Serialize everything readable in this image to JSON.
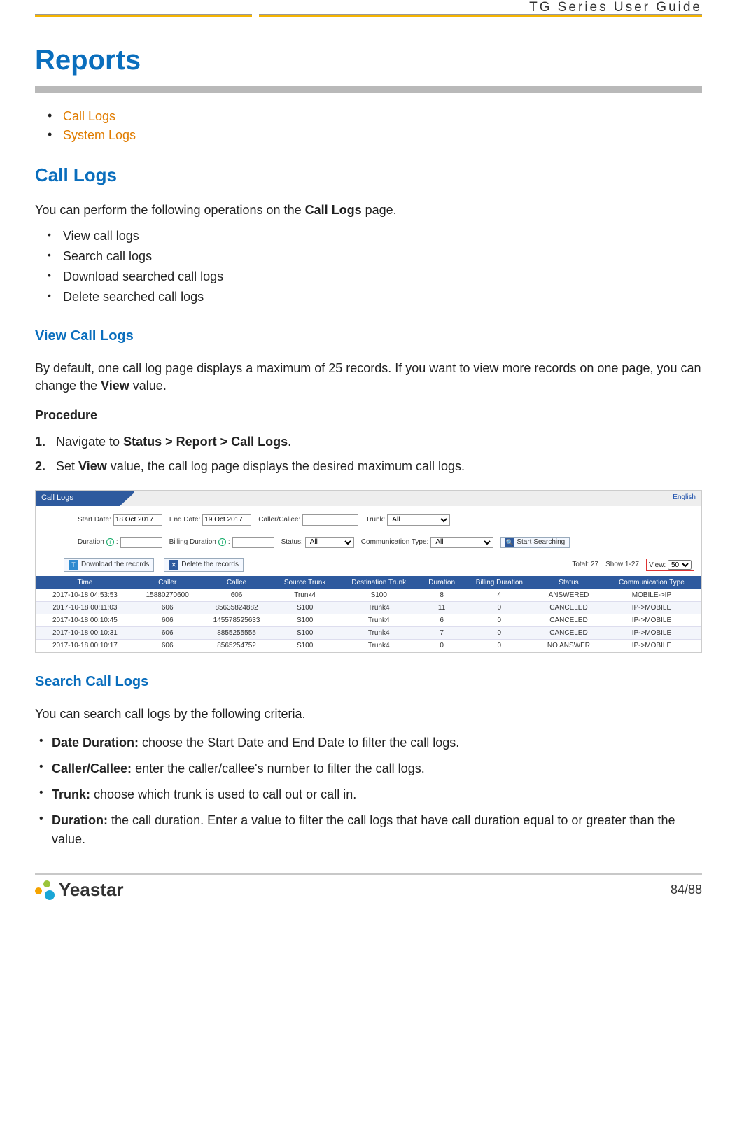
{
  "header": {
    "doc_title": "TG Series User Guide"
  },
  "h1": "Reports",
  "toc": [
    {
      "label": "Call Logs"
    },
    {
      "label": "System Logs"
    }
  ],
  "section_call_logs": {
    "heading": "Call Logs",
    "intro_pre": "You can perform the following operations on the ",
    "intro_bold": "Call Logs",
    "intro_post": " page.",
    "ops": [
      "View call logs",
      "Search call logs",
      "Download searched call logs",
      "Delete searched call logs"
    ]
  },
  "view": {
    "heading": "View Call Logs",
    "para_pre": "By default, one call log page displays a maximum of 25 records. If you want to view more records on one page, you can change the ",
    "para_bold": "View",
    "para_post": " value.",
    "procedure_label": "Procedure",
    "steps": [
      {
        "num": "1.",
        "pre": "Navigate to ",
        "bold": "Status > Report > Call Logs",
        "post": "."
      },
      {
        "num": "2.",
        "pre": "Set ",
        "bold": "View",
        "post": " value, the call log page displays the desired maximum call logs."
      }
    ]
  },
  "screenshot": {
    "tab_title": "Call Logs",
    "english_link": "English",
    "filters": {
      "start_date_label": "Start Date:",
      "start_date_value": "18 Oct 2017",
      "end_date_label": "End Date:",
      "end_date_value": "19 Oct 2017",
      "caller_callee_label": "Caller/Callee:",
      "caller_callee_value": "",
      "trunk_label": "Trunk:",
      "trunk_value": "All",
      "duration_label": "Duration",
      "duration_value": "",
      "billing_duration_label": "Billing Duration",
      "billing_duration_value": "",
      "status_label": "Status:",
      "status_value": "All",
      "comm_type_label": "Communication Type:",
      "comm_type_value": "All",
      "search_button": "Start Searching"
    },
    "actions": {
      "download": "Download the records",
      "delete": "Delete the records",
      "total_label": "Total:",
      "total_value": "27",
      "show_label": "Show:",
      "show_value": "1-27",
      "view_label": "View:",
      "view_value": "50"
    },
    "table": {
      "headers": [
        "Time",
        "Caller",
        "Callee",
        "Source Trunk",
        "Destination Trunk",
        "Duration",
        "Billing Duration",
        "Status",
        "Communication Type"
      ],
      "rows": [
        [
          "2017-10-18 04:53:53",
          "15880270600",
          "606",
          "Trunk4",
          "S100",
          "8",
          "4",
          "ANSWERED",
          "MOBILE->IP"
        ],
        [
          "2017-10-18 00:11:03",
          "606",
          "85635824882",
          "S100",
          "Trunk4",
          "11",
          "0",
          "CANCELED",
          "IP->MOBILE"
        ],
        [
          "2017-10-18 00:10:45",
          "606",
          "145578525633",
          "S100",
          "Trunk4",
          "6",
          "0",
          "CANCELED",
          "IP->MOBILE"
        ],
        [
          "2017-10-18 00:10:31",
          "606",
          "8855255555",
          "S100",
          "Trunk4",
          "7",
          "0",
          "CANCELED",
          "IP->MOBILE"
        ],
        [
          "2017-10-18 00:10:17",
          "606",
          "8565254752",
          "S100",
          "Trunk4",
          "0",
          "0",
          "NO ANSWER",
          "IP->MOBILE"
        ]
      ]
    }
  },
  "search": {
    "heading": "Search Call Logs",
    "intro": "You can search call logs by the following criteria.",
    "criteria": [
      {
        "bold": "Date Duration:",
        "text": " choose the Start Date and End Date to filter the call logs."
      },
      {
        "bold": "Caller/Callee:",
        "text": " enter the caller/callee's number to filter the call logs."
      },
      {
        "bold": "Trunk:",
        "text": " choose which trunk is used to call out or call in."
      },
      {
        "bold": "Duration:",
        "text": " the call duration. Enter a value to filter the call logs that have call duration equal to or greater than the value."
      }
    ]
  },
  "footer": {
    "brand": "Yeastar",
    "page": "84/88"
  }
}
